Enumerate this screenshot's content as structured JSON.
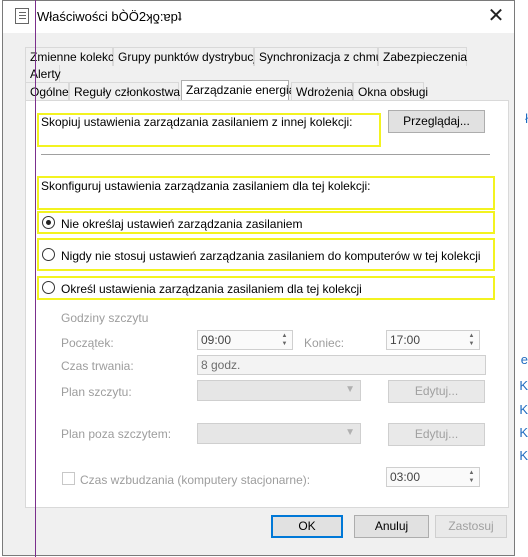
{
  "window": {
    "title": "Właściwości bÒÖ2ʞƍ:ɐpʇ",
    "close_glyph": "✕"
  },
  "tabs_row1": [
    "Zmienne kolekcji",
    "Grupy punktów dystrybucji",
    "Synchronizacja z chmurą",
    "Zabezpieczenia"
  ],
  "tabs_row1b": [
    "Alerty"
  ],
  "tabs_row2": [
    "Ogólne",
    "Reguły członkostwa",
    "Zarządzanie energią",
    "Wdrożenia",
    "Okna obsługi"
  ],
  "panel": {
    "copy_label": "Skopiuj ustawienia zarządzania zasilaniem z innej kolekcji:",
    "browse_button": "Przeglądaj...",
    "configure_label": "Skonfiguruj ustawienia zarządzania zasilaniem dla tej kolekcji:",
    "options": [
      {
        "label": "Nie określaj ustawień zarządzania zasilaniem",
        "selected": true
      },
      {
        "label": "Nigdy nie stosuj ustawień zarządzania zasilaniem do komputerów w tej kolekcji",
        "selected": false
      },
      {
        "label": "Określ ustawienia zarządzania zasilaniem dla tej kolekcji",
        "selected": false
      }
    ],
    "peak": {
      "title": "Godziny szczytu",
      "start_label": "Początek:",
      "start_value": "09:00",
      "end_label": "Koniec:",
      "end_value": "17:00",
      "duration_label": "Czas trwania:",
      "duration_value": "8 godz.",
      "peak_plan_label": "Plan szczytu:",
      "offpeak_plan_label": "Plan poza szczytem:",
      "edit_button": "Edytuj...",
      "wakeup_label": "Czas wzbudzania (komputery stacjonarne):",
      "wakeup_value": "03:00"
    }
  },
  "footer": {
    "ok": "OK",
    "cancel": "Anuluj",
    "apply": "Zastosuj"
  },
  "background": {
    "right_fragments": [
      "ł",
      "e",
      "K",
      "K",
      "K",
      "K"
    ]
  },
  "colors": {
    "highlight": "#f3f320",
    "accent": "#0078d7",
    "marker": "#7b2f8c"
  }
}
